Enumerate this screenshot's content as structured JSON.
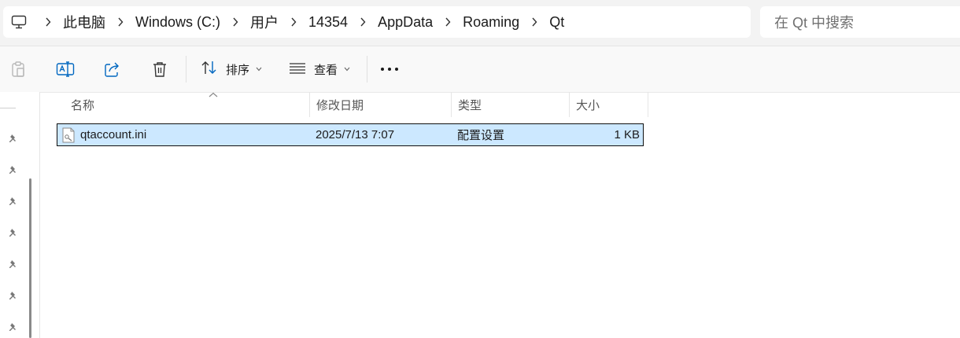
{
  "address_bar": {
    "breadcrumbs": [
      "此电脑",
      "Windows (C:)",
      "用户",
      "14354",
      "AppData",
      "Roaming",
      "Qt"
    ]
  },
  "search": {
    "placeholder": "在 Qt 中搜索"
  },
  "toolbar": {
    "sort_label": "排序",
    "view_label": "查看"
  },
  "columns": {
    "name": "名称",
    "modified": "修改日期",
    "type": "类型",
    "size": "大小"
  },
  "files": [
    {
      "name": "qtaccount.ini",
      "modified": "2025/7/13 7:07",
      "type": "配置设置",
      "size": "1 KB"
    }
  ],
  "colors": {
    "selection_bg": "#cce8ff",
    "topbar_bg": "#f3f3f3",
    "accent": "#0067c0"
  }
}
